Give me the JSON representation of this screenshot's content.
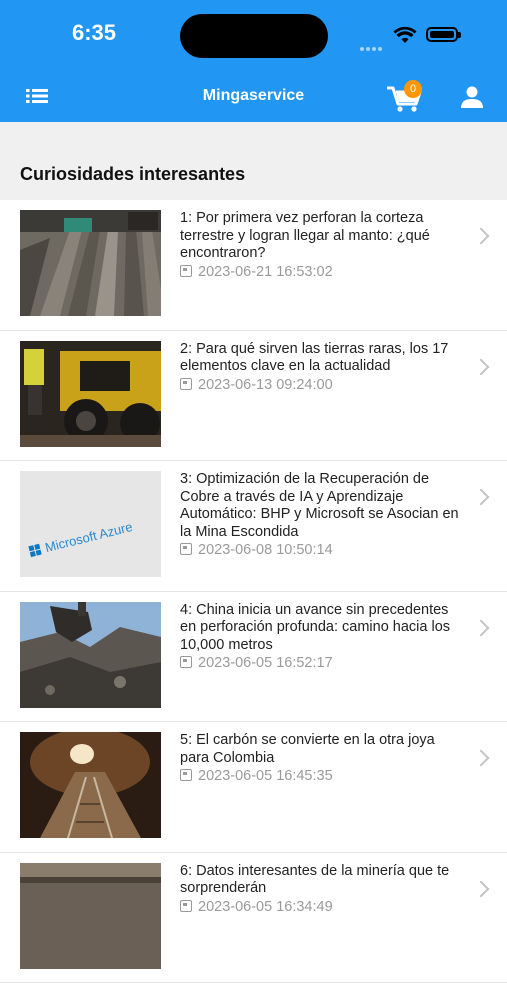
{
  "status_bar": {
    "time": "6:35"
  },
  "header": {
    "title": "Mingaservice",
    "cart_badge": "0"
  },
  "section": {
    "title": "Curiosidades interesantes"
  },
  "articles": [
    {
      "title": "1: Por primera vez perforan la corteza terrestre y logran llegar al manto: ¿qué encontraron?",
      "date": "2023-06-21 16:53:02"
    },
    {
      "title": "2: Para qué sirven las tierras raras, los 17 elementos clave en la actualidad",
      "date": "2023-06-13 09:24:00"
    },
    {
      "title": "3: Optimización de la Recuperación de Cobre a través de IA y Aprendizaje Automático: BHP y Microsoft se Asocian en la Mina Escondida",
      "date": "2023-06-08 10:50:14"
    },
    {
      "title": "4: China inicia un avance sin precedentes en perforación profunda: camino hacia los 10,000 metros",
      "date": "2023-06-05 16:52:17"
    },
    {
      "title": "5: El carbón se convierte en la otra joya para Colombia",
      "date": "2023-06-05 16:45:35"
    },
    {
      "title": "6: Datos interesantes de la minería que te sorprenderán",
      "date": "2023-06-05 16:34:49"
    }
  ],
  "thumb3_text": "Microsoft Azure"
}
